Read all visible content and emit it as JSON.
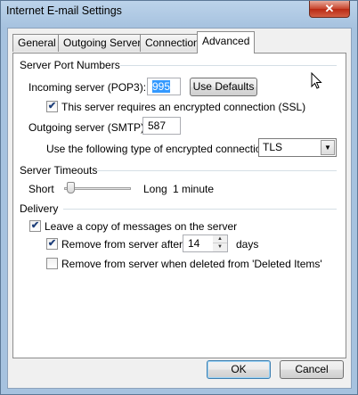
{
  "window": {
    "title": "Internet E-mail Settings",
    "close_glyph": "✕"
  },
  "tabs": [
    {
      "label": "General",
      "active": false
    },
    {
      "label": "Outgoing Server",
      "active": false
    },
    {
      "label": "Connection",
      "active": false
    },
    {
      "label": "Advanced",
      "active": true
    }
  ],
  "ports": {
    "section_label": "Server Port Numbers",
    "incoming_label": "Incoming server (POP3):",
    "incoming_value": "995",
    "use_defaults_label": "Use Defaults",
    "ssl_label": "This server requires an encrypted connection (SSL)",
    "ssl_checked": true,
    "outgoing_label": "Outgoing server (SMTP):",
    "outgoing_value": "587",
    "encryption_label": "Use the following type of encrypted connection:",
    "encryption_value": "TLS"
  },
  "timeouts": {
    "section_label": "Server Timeouts",
    "short_label": "Short",
    "long_label": "Long",
    "value_label": "1 minute",
    "slider_fraction": 0.05
  },
  "delivery": {
    "section_label": "Delivery",
    "leave_copy_label": "Leave a copy of messages on the server",
    "leave_copy_checked": true,
    "remove_after_label": "Remove from server after",
    "remove_after_checked": true,
    "remove_after_days": "14",
    "days_label": "days",
    "remove_deleted_label": "Remove from server when deleted from 'Deleted Items'",
    "remove_deleted_checked": false
  },
  "footer": {
    "ok_label": "OK",
    "cancel_label": "Cancel"
  },
  "check_glyph": "✔"
}
